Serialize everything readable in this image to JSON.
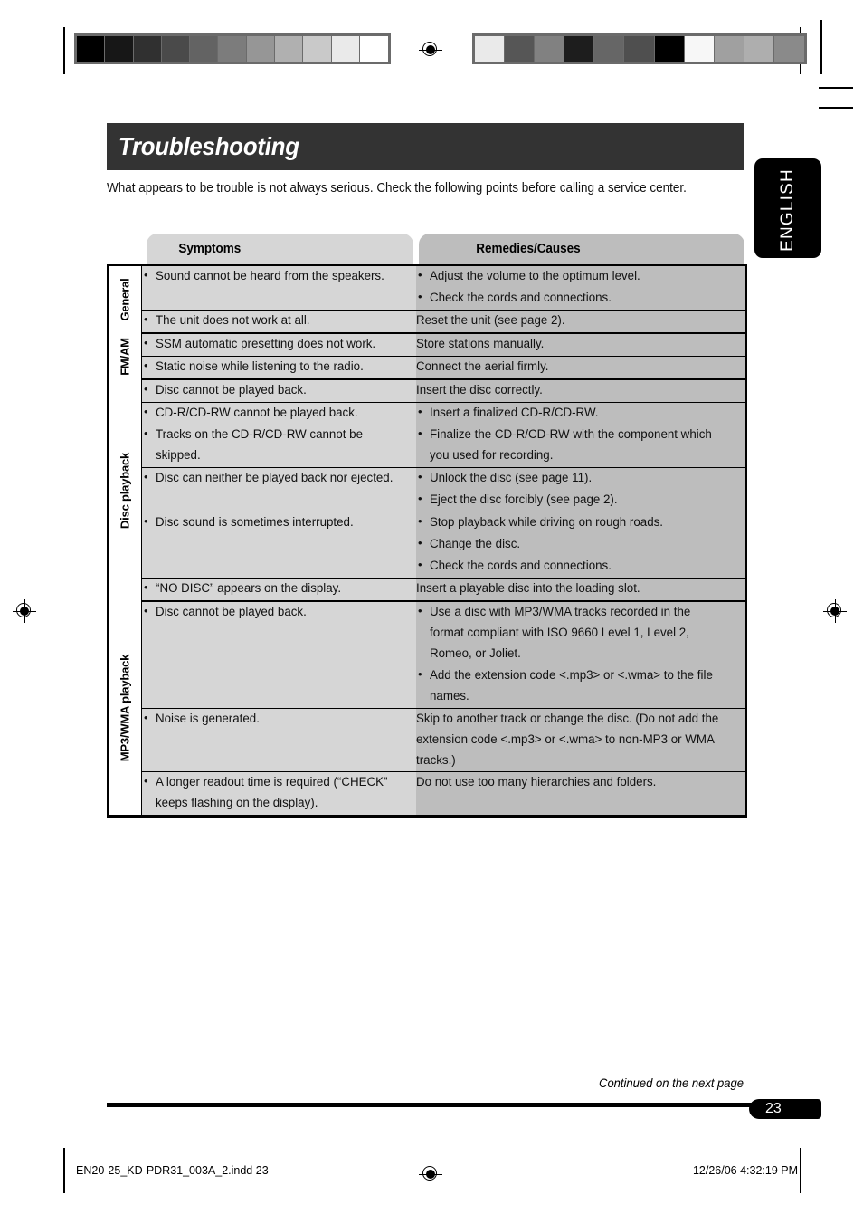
{
  "header": {
    "title": "Troubleshooting",
    "intro": "What appears to be trouble is not always serious. Check the following points before calling a service center.",
    "language_tab": "ENGLISH"
  },
  "colors": {
    "title_bar": "#333333",
    "symptoms_column": "#d6d6d6",
    "remedies_column": "#bdbdbd",
    "rule": "#000000",
    "language_tab": "#000000"
  },
  "table": {
    "columns": [
      "Symptoms",
      "Remedies/Causes"
    ],
    "groups": [
      {
        "label": "General",
        "rows": [
          {
            "symptoms": [
              "Sound cannot be heard from the speakers."
            ],
            "remedies": [
              "Adjust the volume to the optimum level.",
              "Check the cords and connections."
            ],
            "remedies_bulleted": true
          },
          {
            "symptoms": [
              "The unit does not work at all."
            ],
            "remedies": [
              "Reset the unit (see page 2)."
            ],
            "remedies_bulleted": false
          }
        ]
      },
      {
        "label": "FM/AM",
        "rows": [
          {
            "symptoms": [
              "SSM automatic presetting does not work."
            ],
            "remedies": [
              "Store stations manually."
            ],
            "remedies_bulleted": false
          },
          {
            "symptoms": [
              "Static noise while listening to the radio."
            ],
            "remedies": [
              "Connect the aerial firmly."
            ],
            "remedies_bulleted": false
          }
        ]
      },
      {
        "label": "Disc playback",
        "rows": [
          {
            "symptoms": [
              "Disc cannot be played back."
            ],
            "remedies": [
              "Insert the disc correctly."
            ],
            "remedies_bulleted": false
          },
          {
            "symptoms": [
              "CD-R/CD-RW cannot be played back.",
              "Tracks on the CD-R/CD-RW cannot be skipped."
            ],
            "remedies": [
              "Insert a finalized CD-R/CD-RW.",
              "Finalize the CD-R/CD-RW with the component which you used for recording."
            ],
            "remedies_bulleted": true
          },
          {
            "symptoms": [
              "Disc can neither be played back nor ejected."
            ],
            "remedies": [
              "Unlock the disc (see page 11).",
              "Eject the disc forcibly (see page 2)."
            ],
            "remedies_bulleted": true
          },
          {
            "symptoms": [
              "Disc sound is sometimes interrupted."
            ],
            "remedies": [
              "Stop playback while driving on rough roads.",
              "Change the disc.",
              "Check the cords and connections."
            ],
            "remedies_bulleted": true
          },
          {
            "symptoms": [
              "“NO DISC” appears on the display."
            ],
            "remedies": [
              "Insert a playable disc into the loading slot."
            ],
            "remedies_bulleted": false
          }
        ]
      },
      {
        "label": "MP3/WMA playback",
        "rows": [
          {
            "symptoms": [
              "Disc cannot be played back."
            ],
            "remedies": [
              "Use a disc with MP3/WMA tracks recorded in the format compliant with ISO 9660 Level 1, Level 2, Romeo, or Joliet.",
              "Add the extension code <.mp3> or <.wma> to the file names."
            ],
            "remedies_bulleted": true
          },
          {
            "symptoms": [
              "Noise is generated."
            ],
            "remedies": [
              "Skip to another track or change the disc. (Do not add the extension code <.mp3> or <.wma> to non-MP3 or WMA tracks.)"
            ],
            "remedies_bulleted": false
          },
          {
            "symptoms": [
              "A longer readout time is required (“CHECK” keeps flashing on the display)."
            ],
            "remedies": [
              "Do not use too many hierarchies and folders."
            ],
            "remedies_bulleted": false
          }
        ]
      }
    ]
  },
  "footer": {
    "continued": "Continued on the next page",
    "page_number": "23",
    "file_name": "EN20-25_KD-PDR31_003A_2.indd   23",
    "timestamp": "12/26/06   4:32:19 PM"
  },
  "print_marks": {
    "gray_bar_left": [
      "#000000",
      "#171717",
      "#303030",
      "#4a4a4a",
      "#636363",
      "#7c7c7c",
      "#969696",
      "#b0b0b0",
      "#c9c9c9",
      "#eaeaea",
      "#ffffff"
    ],
    "gray_bar_right": [
      "#eaeaea",
      "#565656",
      "#818181",
      "#1d1d1d",
      "#666666",
      "#4f4f4f",
      "#000000",
      "#f7f7f7",
      "#a0a0a0",
      "#aeaeae",
      "#8a8a8a"
    ]
  }
}
